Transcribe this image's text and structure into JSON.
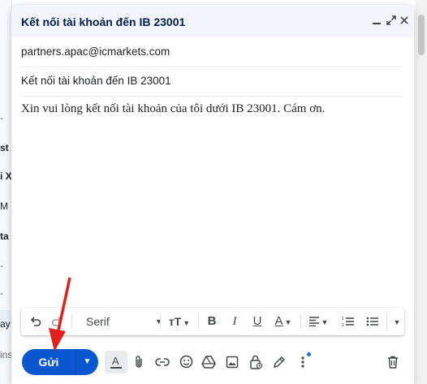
{
  "background": {
    "fragments": [
      "-",
      "st",
      "i X",
      "M",
      "ta",
      "-",
      "-",
      "ay",
      "ins"
    ]
  },
  "compose": {
    "title": "Kết nối tài khoản đến IB 23001",
    "header_buttons": {
      "minimize": "minimize-icon",
      "popout": "popout-icon",
      "close": "close-icon"
    },
    "to_value": "partners.apac@icmarkets.com",
    "subject_value": "Kết nối tài khoản đến IB 23001",
    "body_text": "Xin vui lòng kết nối tài khoản của tôi dưới IB 23001. Cám ơn.",
    "format_toolbar": {
      "font_name": "Serif",
      "undo_icon": "undo-icon",
      "redo_icon": "redo-icon",
      "size_glyph": "тT",
      "bold": "B",
      "italic": "I",
      "underline": "U",
      "text_color": "A"
    },
    "send_label": "Gửi",
    "accent_color": "#0b57d0",
    "annotation_color": "#e3201b"
  }
}
